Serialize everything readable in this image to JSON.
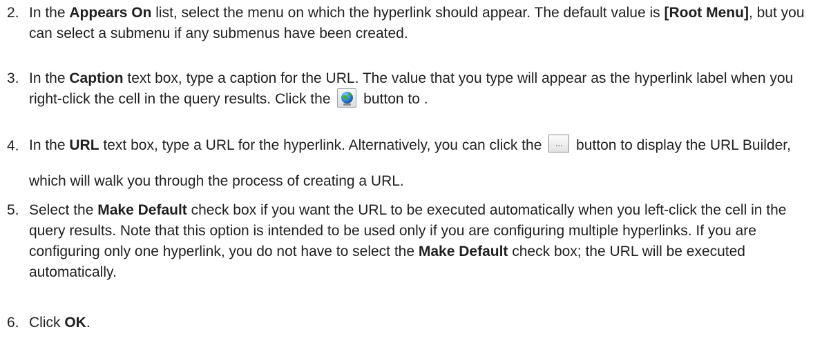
{
  "steps": [
    {
      "number": "2.",
      "t1": "In the ",
      "b1": "Appears On",
      "t2": " list, select the menu on which the hyperlink should appear. The default value is ",
      "b2": "[Root Menu]",
      "t3": ", but you can select a submenu if any submenus have been created."
    },
    {
      "number": "3.",
      "t1": "In the ",
      "b1": "Caption",
      "t2": " text box, type a caption for the URL. The value that you type will appear as the hyperlink label when you right-click the cell in the query results. Click the ",
      "icon": "globe-icon",
      "t3": " button to ."
    },
    {
      "number": "4.",
      "t1": "In the ",
      "b1": "URL",
      "t2": " text box, type a URL for the hyperlink. Alternatively, you can click the ",
      "button_label": "...",
      "t3": " button to display the URL Builder, which will walk you through the process of creating a URL."
    },
    {
      "number": "5.",
      "t1": "Select the ",
      "b1": "Make Default",
      "t2": " check box if you want the URL to be executed automatically when you left-click the cell in the query results. Note that this option is intended to be used only if you are configuring multiple hyperlinks. If you are configuring only one hyperlink, you do not have to select the ",
      "b2": "Make Default",
      "t3": " check box; the URL will be executed automatically."
    },
    {
      "number": "6.",
      "t1": "Click ",
      "b1": "OK",
      "t2": "."
    }
  ]
}
